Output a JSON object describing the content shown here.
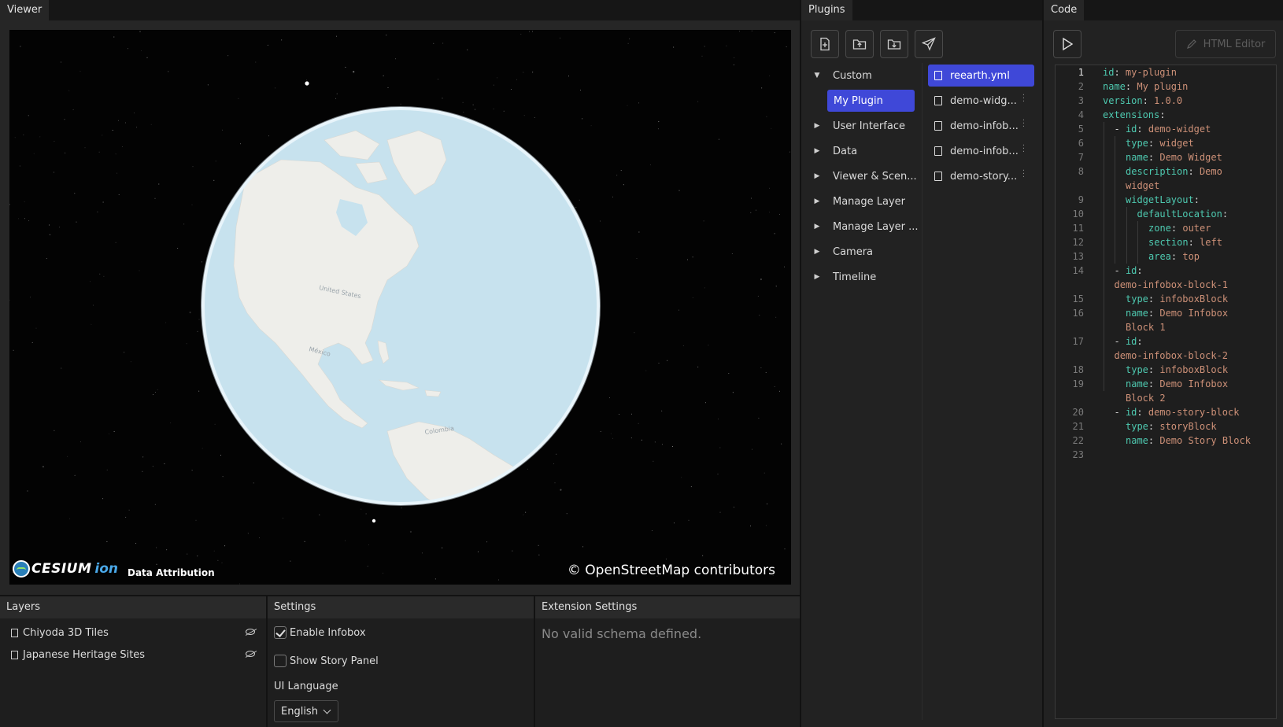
{
  "viewer": {
    "tab": "Viewer",
    "logo_word": "CESIUM",
    "logo_ion": "ion",
    "data_attribution": "Data Attribution",
    "osm_credit": "© OpenStreetMap contributors",
    "map_labels": [
      "United States",
      "Mexico",
      "Colombia"
    ]
  },
  "plugins": {
    "tab": "Plugins",
    "toolbar_icons": [
      "new-file-icon",
      "upload-icon",
      "download-icon",
      "send-icon"
    ],
    "tree": [
      {
        "label": "Custom",
        "expanded": true
      },
      {
        "label": "User Interface",
        "expanded": false
      },
      {
        "label": "Data",
        "expanded": false
      },
      {
        "label": "Viewer & Scen...",
        "expanded": false
      },
      {
        "label": "Manage Layer",
        "expanded": false
      },
      {
        "label": "Manage Layer ...",
        "expanded": false
      },
      {
        "label": "Camera",
        "expanded": false
      },
      {
        "label": "Timeline",
        "expanded": false
      }
    ],
    "selected_plugin": "My Plugin",
    "files": [
      "reearth.yml",
      "demo-widg...",
      "demo-infob...",
      "demo-infob...",
      "demo-story..."
    ],
    "accent": "#3f48d8"
  },
  "code": {
    "tab": "Code",
    "html_editor_label": "HTML Editor",
    "lines": [
      {
        "n": "1",
        "indent": 0,
        "key": "id",
        "val": "my-plugin"
      },
      {
        "n": "2",
        "indent": 0,
        "key": "name",
        "val": "My plugin"
      },
      {
        "n": "3",
        "indent": 0,
        "key": "version",
        "val": "1.0.0"
      },
      {
        "n": "4",
        "indent": 0,
        "key": "extensions",
        "val": ""
      },
      {
        "n": "5",
        "indent": 1,
        "dash": true,
        "key": "id",
        "val": "demo-widget"
      },
      {
        "n": "6",
        "indent": 2,
        "key": "type",
        "val": "widget"
      },
      {
        "n": "7",
        "indent": 2,
        "key": "name",
        "val": "Demo Widget"
      },
      {
        "n": "8",
        "indent": 2,
        "key": "description",
        "val": "Demo"
      },
      {
        "n": "",
        "indent": 2,
        "cont": "widget"
      },
      {
        "n": "9",
        "indent": 2,
        "key": "widgetLayout",
        "val": ""
      },
      {
        "n": "10",
        "indent": 3,
        "key": "defaultLocation",
        "val": ""
      },
      {
        "n": "11",
        "indent": 4,
        "key": "zone",
        "val": "outer"
      },
      {
        "n": "12",
        "indent": 4,
        "key": "section",
        "val": "left"
      },
      {
        "n": "13",
        "indent": 4,
        "key": "area",
        "val": "top"
      },
      {
        "n": "14",
        "indent": 1,
        "dash": true,
        "key": "id",
        "val": ""
      },
      {
        "n": "",
        "indent": 1,
        "cont": "demo-infobox-block-1"
      },
      {
        "n": "15",
        "indent": 2,
        "key": "type",
        "val": "infoboxBlock"
      },
      {
        "n": "16",
        "indent": 2,
        "key": "name",
        "val": "Demo Infobox"
      },
      {
        "n": "",
        "indent": 2,
        "cont": "Block 1"
      },
      {
        "n": "17",
        "indent": 1,
        "dash": true,
        "key": "id",
        "val": ""
      },
      {
        "n": "",
        "indent": 1,
        "cont": "demo-infobox-block-2"
      },
      {
        "n": "18",
        "indent": 2,
        "key": "type",
        "val": "infoboxBlock"
      },
      {
        "n": "19",
        "indent": 2,
        "key": "name",
        "val": "Demo Infobox"
      },
      {
        "n": "",
        "indent": 2,
        "cont": "Block 2"
      },
      {
        "n": "20",
        "indent": 1,
        "dash": true,
        "key": "id",
        "val": "demo-story-block"
      },
      {
        "n": "21",
        "indent": 2,
        "key": "type",
        "val": "storyBlock"
      },
      {
        "n": "22",
        "indent": 2,
        "key": "name",
        "val": "Demo Story Block"
      },
      {
        "n": "23",
        "indent": 0,
        "key": "",
        "val": ""
      }
    ]
  },
  "layers": {
    "title": "Layers",
    "items": [
      "Chiyoda 3D Tiles",
      "Japanese Heritage Sites"
    ]
  },
  "settings": {
    "title": "Settings",
    "enable_infobox": {
      "label": "Enable Infobox",
      "checked": true
    },
    "show_story_panel": {
      "label": "Show Story Panel",
      "checked": false
    },
    "ui_language_label": "UI Language",
    "ui_language_value": "English"
  },
  "extension_settings": {
    "title": "Extension Settings",
    "message": "No valid schema defined."
  }
}
